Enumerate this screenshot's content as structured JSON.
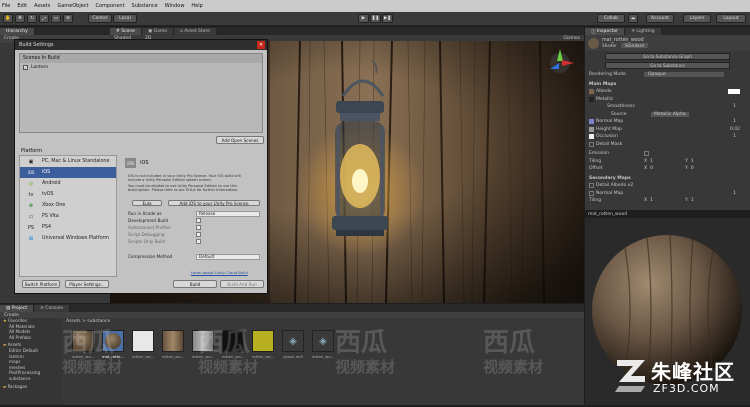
{
  "menu": [
    "File",
    "Edit",
    "Assets",
    "GameObject",
    "Component",
    "Substance",
    "Window",
    "Help"
  ],
  "toolbar": {
    "center_label": "Center",
    "local_label": "Local",
    "collab_label": "Collab",
    "account_label": "Account",
    "layers_label": "Layers",
    "layout_label": "Layout"
  },
  "hierarchy": {
    "tab": "Hierarchy",
    "create_label": "Create"
  },
  "scene_tabs": {
    "scene": "Scene",
    "game": "Game",
    "store": "Asset Store",
    "shaded": "Shaded",
    "twod": "2D",
    "gizmos": "Gizmos"
  },
  "build_settings": {
    "title": "Build Settings",
    "scenes_header": "Scenes In Build",
    "scene_item": "Lantern",
    "add_open_scenes": "Add Open Scenes",
    "platform_header": "Platform",
    "platforms": [
      {
        "icon": "pc-icon",
        "label": "PC, Mac & Linux Standalone"
      },
      {
        "icon": "ios-icon",
        "label": "iOS"
      },
      {
        "icon": "android-icon",
        "label": "Android"
      },
      {
        "icon": "tvos-icon",
        "label": "tvOS"
      },
      {
        "icon": "xbox-icon",
        "label": "Xbox One"
      },
      {
        "icon": "psvita-icon",
        "label": "PS Vita"
      },
      {
        "icon": "ps4-icon",
        "label": "PS4"
      },
      {
        "icon": "uwp-icon",
        "label": "Universal Windows Platform"
      }
    ],
    "selected_platform": "iOS",
    "info_lines": [
      "iOS is not included in your Unity Pro license. Your iOS build will",
      "include a Unity Personal Edition splash screen.",
      "You must be eligible to use Unity Personal Edition to use this",
      "build option. Please refer to our EULA for further information."
    ],
    "eula_button": "Eula",
    "add_license_button": "Add iOS to your Unity Pro license",
    "settings": [
      {
        "label": "Run in Xcode as",
        "value": "Release"
      },
      {
        "label": "Development Build",
        "value": ""
      },
      {
        "label": "Autoconnect Profiler",
        "value": ""
      },
      {
        "label": "Script Debugging",
        "value": ""
      },
      {
        "label": "Scripts Only Build",
        "value": ""
      }
    ],
    "compression_label": "Compression Method",
    "compression_value": "Default",
    "cloud_link": "Learn about Unity Cloud Build",
    "switch_platform": "Switch Platform",
    "player_settings": "Player Settings...",
    "build": "Build",
    "build_and_run": "Build And Run"
  },
  "inspector": {
    "tab": "Inspector",
    "lighting_tab": "Lighting",
    "material_name": "mat_rotten_wood",
    "shader_label": "Shader",
    "shader_value": "Standard",
    "go_to_graph": "Go to Substance Graph",
    "go_to_substance": "Go to Substance",
    "rendering_mode_label": "Rendering Mode",
    "rendering_mode_value": "Opaque",
    "main_maps": "Main Maps",
    "albedo": "Albedo",
    "metallic": "Metallic",
    "smoothness": "Smoothness",
    "smoothness_value": "1",
    "source_label": "Source",
    "source_value": "Metallic Alpha",
    "normal_map": "Normal Map",
    "normal_value": "1",
    "height_map": "Height Map",
    "height_value": "0.02",
    "occlusion": "Occlusion",
    "occlusion_value": "1",
    "detail_mask": "Detail Mask",
    "emission": "Emission",
    "tiling": "Tiling",
    "offset": "Offset",
    "x_label": "X",
    "y_label": "Y",
    "tiling_x": "1",
    "tiling_y": "1",
    "offset_x": "0",
    "offset_y": "0",
    "secondary_maps": "Secondary Maps",
    "detail_albedo": "Detail Albedo x2",
    "sec_normal_map": "Normal Map",
    "sec_normal_value": "1",
    "sec_tiling": "Tiling",
    "sec_tiling_x": "1",
    "sec_tiling_y": "1",
    "preview_name": "mat_rotten_wood"
  },
  "project": {
    "tab": "Project",
    "console_tab": "Console",
    "create_label": "Create",
    "breadcrumb": "Assets > substance",
    "favorites": "Favorites",
    "fav_items": [
      "All Materials",
      "All Models",
      "All Prefabs"
    ],
    "assets": "Assets",
    "asset_items": [
      "Editor Default",
      "lantern",
      "maps",
      "meshes",
      "PostProcessing",
      "substance"
    ],
    "packages": "Packages",
    "thumbs": [
      {
        "label": "rotten_wo..."
      },
      {
        "label": "mat_rotte..."
      },
      {
        "label": "rotten_wo..."
      },
      {
        "label": "rotten_wo..."
      },
      {
        "label": "rotten_wo..."
      },
      {
        "label": "rotten_wo..."
      },
      {
        "label": "rotten_wo..."
      },
      {
        "label": "graph.mdl"
      },
      {
        "label": "rotten_wo..."
      }
    ]
  },
  "watermark": {
    "cn1": "西瓜",
    "cn2": "视频素材",
    "brand": "朱峰社区",
    "url": "ZF3D.COM"
  }
}
